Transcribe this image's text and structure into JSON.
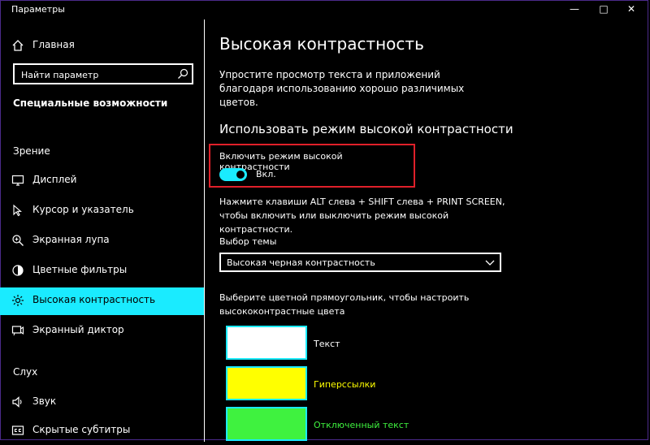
{
  "window": {
    "title": "Параметры",
    "buttons": {
      "minimize": "—",
      "maximize": "□",
      "close": "✕"
    }
  },
  "sidebar": {
    "home_label": "Главная",
    "search_placeholder": "Найти параметр",
    "category_title": "Специальные возможности",
    "groups": [
      {
        "label": "Зрение",
        "items": [
          {
            "label": "Дисплей",
            "icon": "display-icon"
          },
          {
            "label": "Курсор и указатель",
            "icon": "cursor-icon"
          },
          {
            "label": "Экранная лупа",
            "icon": "magnifier-icon"
          },
          {
            "label": "Цветные фильтры",
            "icon": "color-filter-icon"
          },
          {
            "label": "Высокая контрастность",
            "icon": "high-contrast-icon",
            "active": true
          },
          {
            "label": "Экранный диктор",
            "icon": "narrator-icon"
          }
        ]
      },
      {
        "label": "Слух",
        "items": [
          {
            "label": "Звук",
            "icon": "speaker-icon"
          },
          {
            "label": "Скрытые субтитры",
            "icon": "captions-icon"
          }
        ]
      }
    ]
  },
  "main": {
    "title": "Высокая контрастность",
    "description": "Упростите просмотр текста и приложений благодаря использованию хорошо различимых цветов.",
    "section_title": "Использовать режим высокой контрастности",
    "toggle": {
      "label": "Включить режим высокой контрастности",
      "state": "Вкл.",
      "on": true
    },
    "shortcut_hint": "Нажмите клавиши ALT слева + SHIFT слева + PRINT SCREEN, чтобы включить или выключить режим высокой контрастности.",
    "theme": {
      "label": "Выбор темы",
      "value": "Высокая черная контрастность"
    },
    "color_hint": "Выберите цветной прямоугольник, чтобы настроить высококонтрастные цвета",
    "swatches": [
      {
        "label": "Текст",
        "color": "#ffffff",
        "text_color": "#ffffff"
      },
      {
        "label": "Гиперссылки",
        "color": "#ffff00",
        "text_color": "#ffff00"
      },
      {
        "label": "Отключенный текст",
        "color": "#3ff23f",
        "text_color": "#3ff23f"
      }
    ]
  },
  "colors": {
    "accent": "#1aebff",
    "highlight_box": "#e0202a",
    "background": "#000000"
  }
}
